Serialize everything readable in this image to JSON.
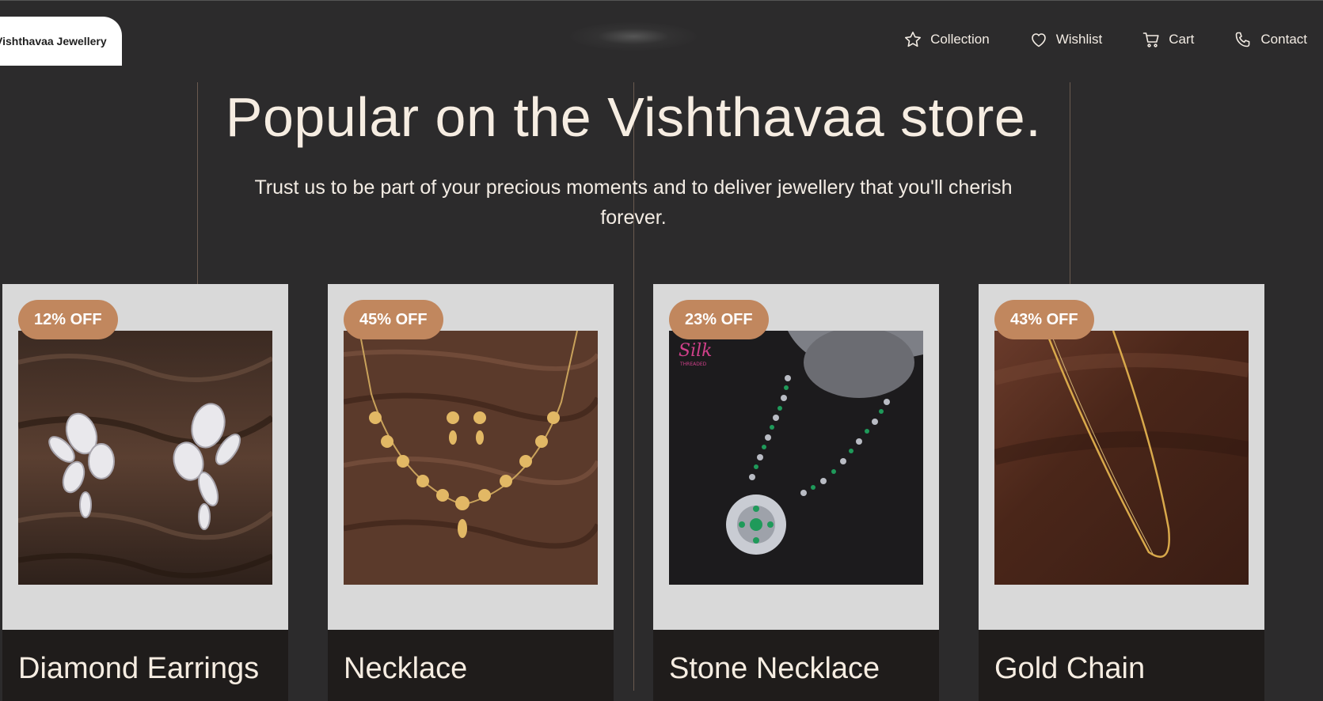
{
  "brand": {
    "name": "Vishthavaa Jewellery"
  },
  "nav": [
    {
      "label": "Collection",
      "icon": "star-icon"
    },
    {
      "label": "Wishlist",
      "icon": "heart-icon"
    },
    {
      "label": "Cart",
      "icon": "cart-icon"
    },
    {
      "label": "Contact",
      "icon": "phone-icon"
    }
  ],
  "hero": {
    "title": "Popular on the Vishthavaa store.",
    "subtitle": "Trust us to be part of your precious moments and to deliver jewellery that you'll cherish forever."
  },
  "products": [
    {
      "name": "Diamond Earrings",
      "discount": "12% OFF",
      "image": "diamond-earrings-image"
    },
    {
      "name": "Necklace",
      "discount": "45% OFF",
      "image": "gold-necklace-image"
    },
    {
      "name": "Stone Necklace",
      "discount": "23% OFF",
      "image": "stone-necklace-image",
      "image_watermark": "Silk THREADED"
    },
    {
      "name": "Gold Chain",
      "discount": "43% OFF",
      "image": "gold-chain-image"
    }
  ],
  "colors": {
    "background": "#2c2b2c",
    "badge": "#c1875e",
    "card": "#d9d9d9",
    "title_bar": "#1f1c1b",
    "text": "#f3ece4"
  }
}
